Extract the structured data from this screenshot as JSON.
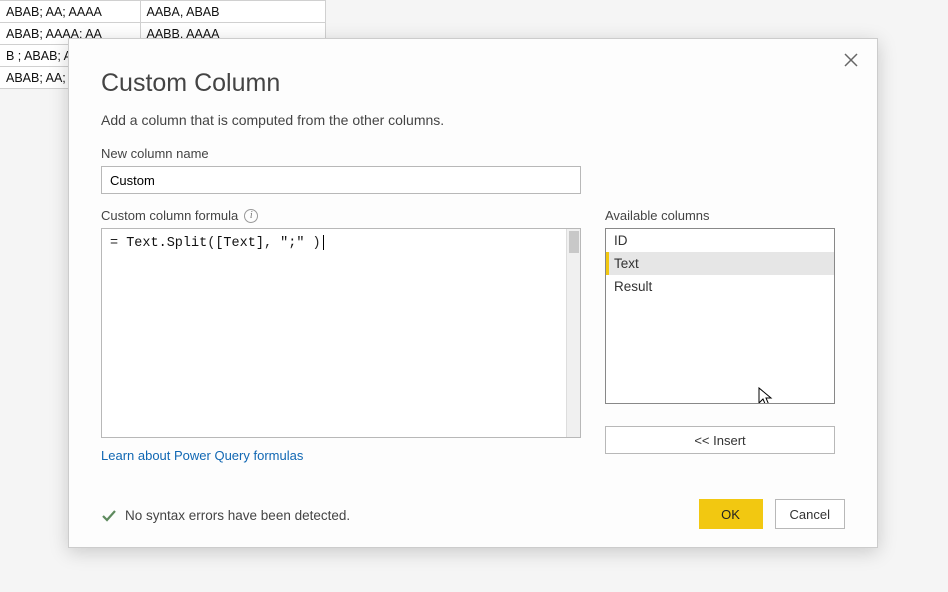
{
  "background_table": {
    "rows": [
      [
        "ABAB; AA; AAAA",
        "AABA, ABAB"
      ],
      [
        "ABAB; AAAA: AA",
        "AABB. AAAA"
      ],
      [
        "B ; ABAB; A",
        ""
      ],
      [
        "ABAB; AA;",
        ""
      ]
    ]
  },
  "dialog": {
    "title": "Custom Column",
    "subtitle": "Add a column that is computed from the other columns.",
    "new_column_label": "New column name",
    "new_column_value": "Custom",
    "formula_label": "Custom column formula",
    "formula_value": "= Text.Split([Text], \";\" )",
    "learn_link": "Learn about Power Query formulas",
    "available_label": "Available columns",
    "available_columns": [
      {
        "name": "ID"
      },
      {
        "name": "Text"
      },
      {
        "name": "Result"
      }
    ],
    "selected_column_index": 1,
    "insert_label": "<< Insert",
    "status_text": "No syntax errors have been detected.",
    "ok_label": "OK",
    "cancel_label": "Cancel"
  },
  "colors": {
    "accent": "#f2c811",
    "link": "#1067b3"
  }
}
